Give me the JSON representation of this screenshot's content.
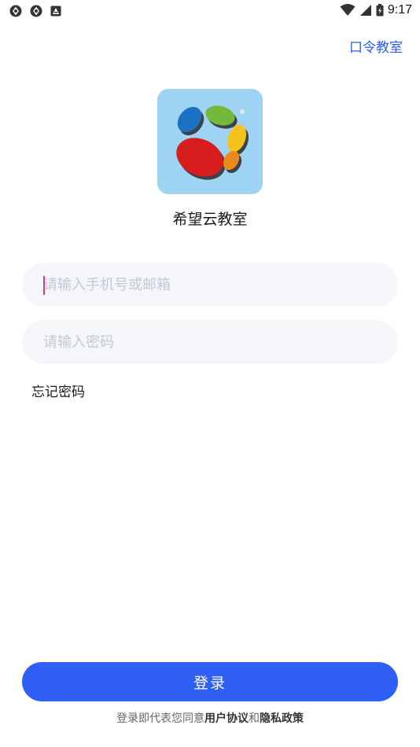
{
  "status_bar": {
    "time": "9:17",
    "left_icons": [
      "app-notification-icon",
      "app-notification-icon",
      "photo-notification-icon"
    ],
    "right_icons": [
      "wifi-icon",
      "cell-signal-icon",
      "battery-icon"
    ]
  },
  "header": {
    "link_label": "口令教室"
  },
  "app": {
    "name": "希望云教室",
    "logo_icon": "app-logo-icon"
  },
  "form": {
    "phone_placeholder": "请输入手机号或邮箱",
    "password_placeholder": "请输入密码",
    "forgot_label": "忘记密码"
  },
  "footer": {
    "login_label": "登录",
    "agreement_prefix": "登录即代表您同意",
    "user_agreement": "用户协议",
    "and": "和",
    "privacy_policy": "隐私政策"
  },
  "colors": {
    "accent": "#2f5ff5",
    "link": "#2f5bf5",
    "logo_bg": "#9fd3f4",
    "input_bg": "#f5f6fa"
  }
}
